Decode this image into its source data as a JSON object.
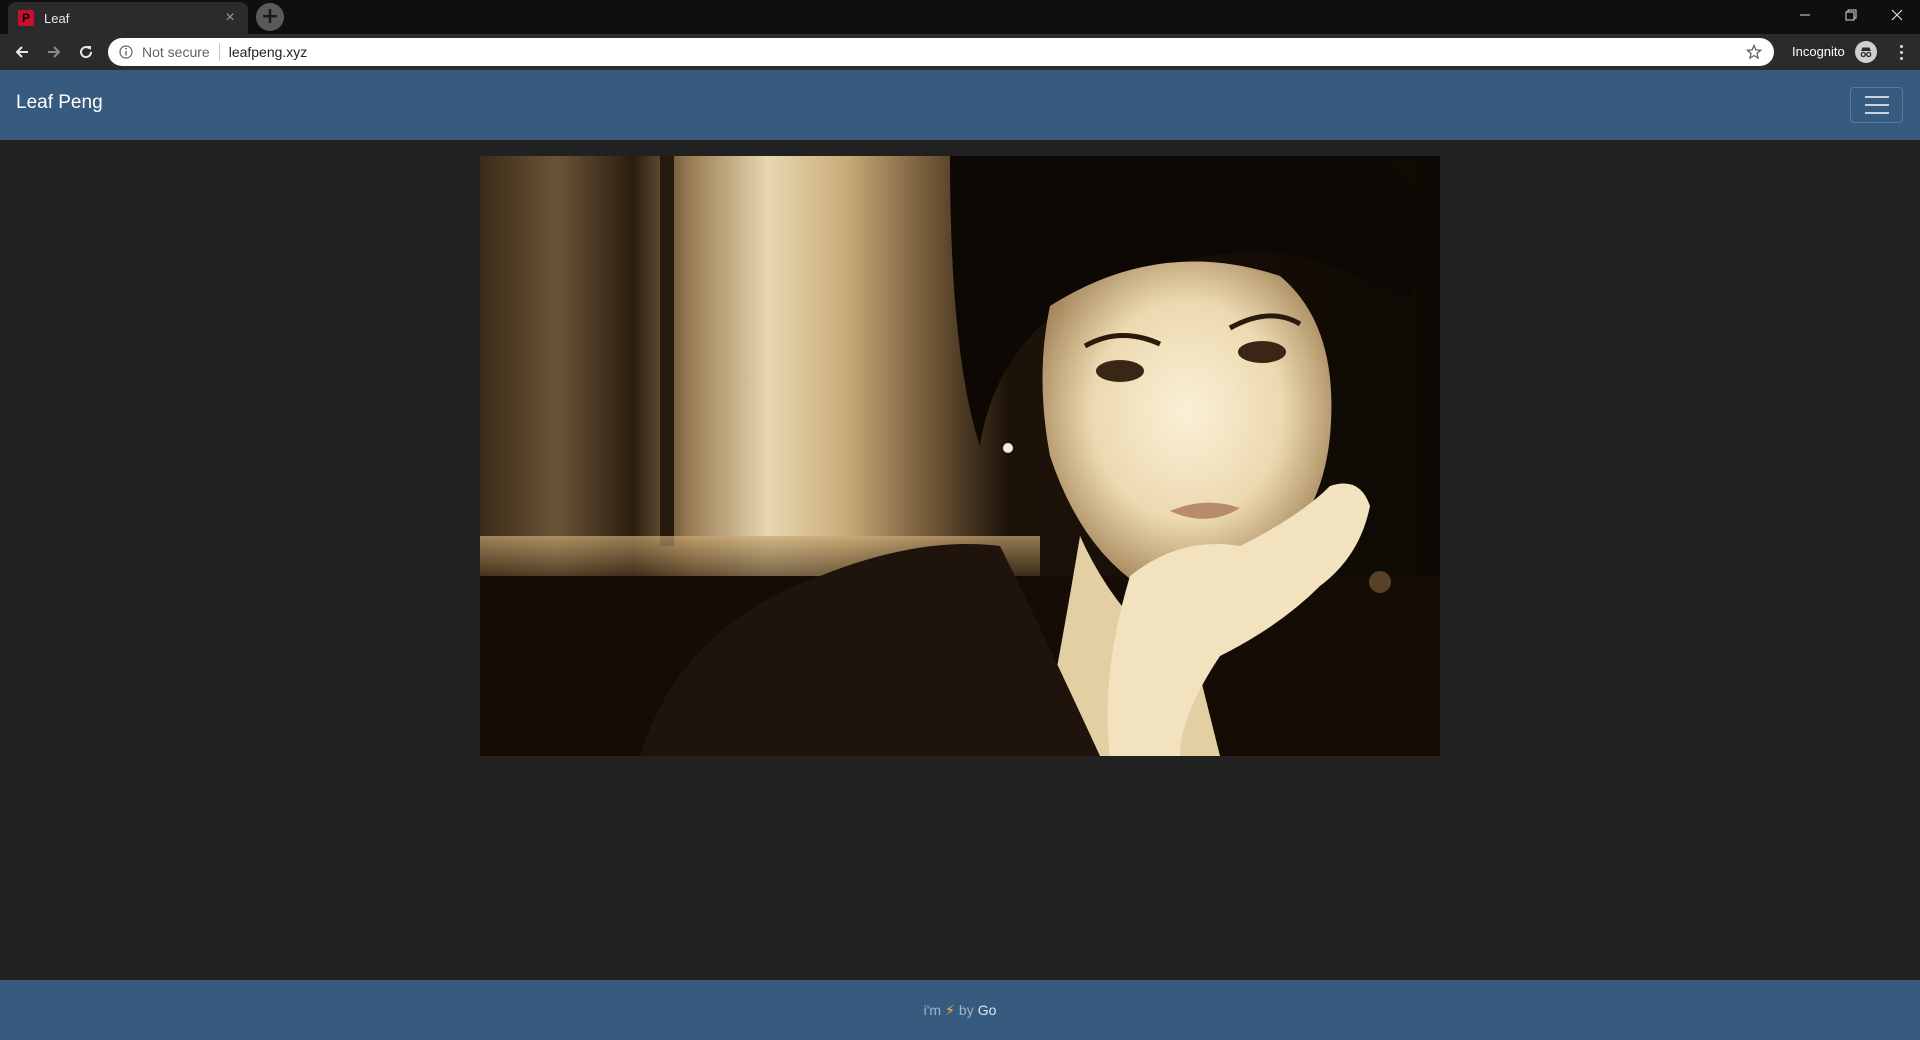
{
  "browser": {
    "tab": {
      "title": "Leaf",
      "favicon_letter": "P"
    },
    "security_label": "Not secure",
    "url": "leafpeng.xyz",
    "incognito_label": "Incognito"
  },
  "site": {
    "brand": "Leaf Peng",
    "footer": {
      "prefix": "i'm",
      "bolt": "⚡",
      "by": "by",
      "link": "Go"
    }
  },
  "colors": {
    "navbar": "#375a7f",
    "page_background": "#212121",
    "footer_text": "#9fb4ca"
  },
  "hero": {
    "alt": "sepia portrait"
  }
}
